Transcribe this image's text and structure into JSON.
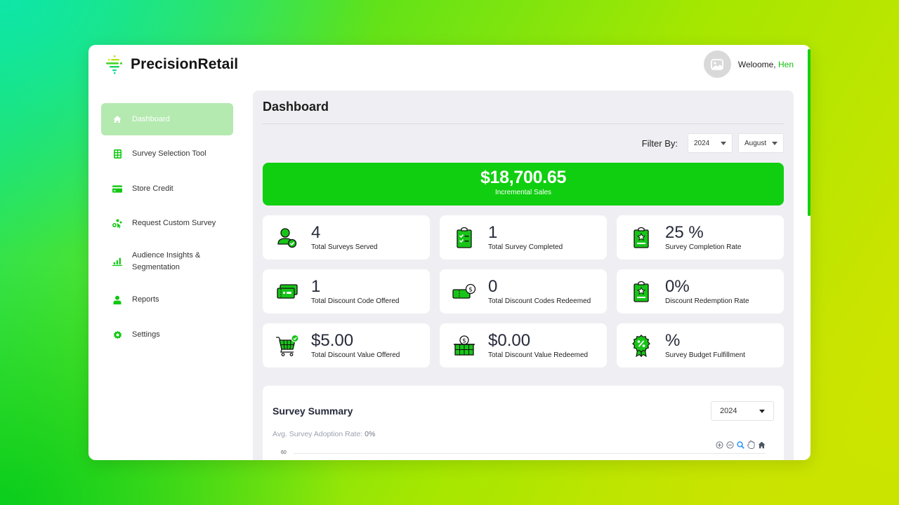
{
  "app": {
    "brand": "PrecisionRetail",
    "welcome_prefix": "Weloome, ",
    "user_name": "Hen"
  },
  "colors": {
    "accent": "#10cf10",
    "active_nav_bg": "#b4e9b0",
    "panel_bg": "#efeff3",
    "text_dark": "#262a3a"
  },
  "sidebar": {
    "items": [
      {
        "label": "Dashboard",
        "icon": "home-icon",
        "active": true
      },
      {
        "label": "Survey Selection Tool",
        "icon": "table-icon",
        "active": false
      },
      {
        "label": "Store Credit",
        "icon": "credit-card-icon",
        "active": false
      },
      {
        "label": "Request Custom Survey",
        "icon": "custom-request-icon",
        "active": false
      },
      {
        "label": "Audience Insights & Segmentation",
        "icon": "bar-chart-icon",
        "active": false
      },
      {
        "label": "Reports",
        "icon": "user-icon",
        "active": false
      },
      {
        "label": "Settings",
        "icon": "gear-icon",
        "active": false
      }
    ]
  },
  "main": {
    "title": "Dashboard",
    "filter": {
      "label": "Filter By:",
      "year": "2024",
      "month": "August"
    },
    "banner": {
      "amount": "$18,700.65",
      "label": "Incremental Sales"
    },
    "stats": [
      {
        "value": "4",
        "label": "Total Surveys Served",
        "icon": "user-check-icon"
      },
      {
        "value": "1",
        "label": "Total Survey Completed",
        "icon": "clipboard-checklist-icon"
      },
      {
        "value": "25 %",
        "label": "Survey Completion Rate",
        "icon": "clipboard-star-icon"
      },
      {
        "value": "1",
        "label": "Total Discount Code Offered",
        "icon": "tickets-icon"
      },
      {
        "value": "0",
        "label": "Total Discount Codes Redeemed",
        "icon": "ticket-dollar-icon"
      },
      {
        "value": "0%",
        "label": "Discount Redemption Rate",
        "icon": "clipboard-star-icon"
      },
      {
        "value": "$5.00",
        "label": "Total Discount Value Offered",
        "icon": "cart-check-icon"
      },
      {
        "value": "$0.00",
        "label": "Total Discount Value Redeemed",
        "icon": "basket-dollar-icon"
      },
      {
        "value": "%",
        "label": "Survey Budget Fulfillment",
        "icon": "percent-badge-icon"
      }
    ],
    "summary": {
      "title": "Survey Summary",
      "year": "2024",
      "adoption_label": "Avg. Survey Adoption Rate: ",
      "adoption_value": "0%",
      "y_tick_top": "60",
      "tools": [
        "zoom-in-icon",
        "zoom-out-icon",
        "zoom-select-icon",
        "pan-hand-icon",
        "reset-home-icon"
      ]
    }
  }
}
